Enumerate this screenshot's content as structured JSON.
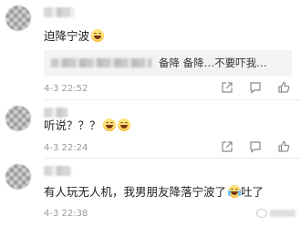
{
  "comments": [
    {
      "text": "迫降宁波",
      "emoji": "smiling-emoji",
      "reply": {
        "text": "备降 备降…不要吓我…"
      },
      "time": "4-3 22:52"
    },
    {
      "text": "听说？？？",
      "emoji": "laughing-emoji",
      "time": "4-3 22:24"
    },
    {
      "text": "有人玩无人机，我男朋友降落宁波了",
      "emoji": "crying-emoji",
      "text_after": "吐了",
      "time": "4-3 22:38"
    }
  ],
  "actions": [
    "share-icon",
    "comment-icon",
    "like-icon"
  ],
  "colors": {
    "time": "#9a9a9a",
    "reply_bg": "#f3f3f3",
    "text": "#222222"
  }
}
